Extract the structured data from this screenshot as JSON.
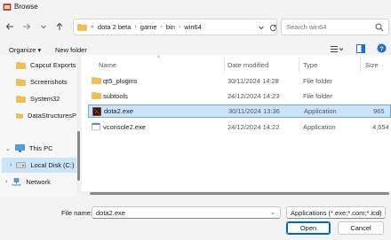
{
  "window": {
    "title": "Browse"
  },
  "address": {
    "crumbs": [
      "dota 2 beta",
      "game",
      "bin",
      "win64"
    ],
    "overflow": "«"
  },
  "search": {
    "placeholder": "Search win64"
  },
  "toolbar": {
    "organize": "Organize",
    "new_folder": "New folder"
  },
  "nav": {
    "quick": [
      "Capcut Exports",
      "Screenshots",
      "System32",
      "DataStructuresP"
    ],
    "this_pc": "This PC",
    "local_disk": "Local Disk (C:)",
    "network": "Network"
  },
  "columns": {
    "name": "Name",
    "date": "Date modified",
    "type": "Type",
    "size": "Size"
  },
  "files": [
    {
      "name": "qt5_plugins",
      "date": "30/11/2024 14:28",
      "type": "File folder",
      "size": "",
      "icon": "folder-icon"
    },
    {
      "name": "subtools",
      "date": "24/12/2024 14:23",
      "type": "File folder",
      "size": "",
      "icon": "folder-icon"
    },
    {
      "name": "dota2.exe",
      "date": "30/11/2024 13:36",
      "type": "Application",
      "size": "965",
      "icon": "dota-app-icon"
    },
    {
      "name": "vconsole2.exe",
      "date": "24/12/2024 14:22",
      "type": "Application",
      "size": "4,654",
      "icon": "app-icon"
    }
  ],
  "bottom": {
    "file_name_label": "File name:",
    "file_name_value": "dota2.exe",
    "filter": "Applications (*.exe;*.com;*.icd)",
    "open": "Open",
    "cancel": "Cancel"
  },
  "colors": {
    "accent": "#0067c0",
    "selection": "#cce4f7",
    "folder": "#f0c04a"
  }
}
